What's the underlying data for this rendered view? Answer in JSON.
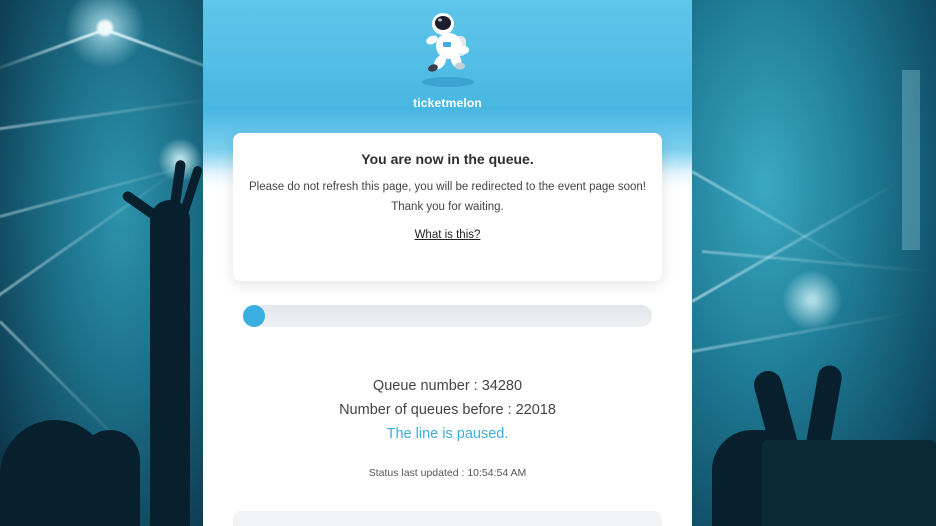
{
  "brand": {
    "name": "ticketmelon",
    "logo_icon": "astronaut-icon"
  },
  "notice_card": {
    "title": "You are now in the queue.",
    "body": "Please do not refresh this page, you will be redirected to the event page soon! Thank you for waiting.",
    "link_label": "What is this?"
  },
  "progress": {
    "fraction": 0.02
  },
  "queue": {
    "queue_number_label": "Queue number : 34280",
    "queues_before_label": "Number of queues before : 22018",
    "status_message": "The line is paused."
  },
  "status": {
    "last_updated": "Status last updated : 10:54:54 AM"
  },
  "colors": {
    "accent": "#3aaede",
    "header_blue": "#49b7e2"
  }
}
